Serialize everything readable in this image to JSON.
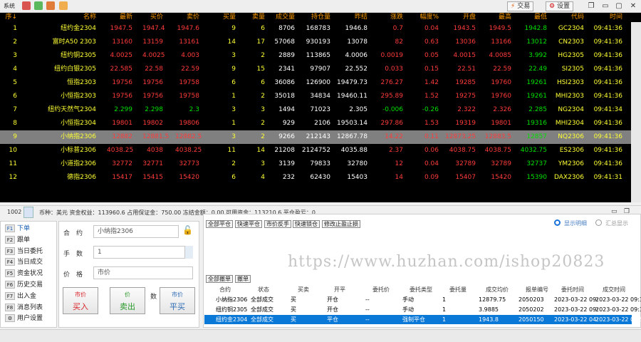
{
  "titlebar": {
    "system_label": "系统",
    "trade_button": "交易",
    "settings_button": "设置",
    "win_restore": "❐",
    "win_min": "▭",
    "win_max": "▢",
    "win_close": "✕"
  },
  "quote_table": {
    "columns": [
      "序↓",
      "名称",
      "最新",
      "买价",
      "卖价",
      "买量",
      "卖量",
      "成交量",
      "持仓量",
      "昨结",
      "涨跌",
      "幅度%",
      "开盘",
      "最高",
      "最低",
      "代码",
      "时间"
    ],
    "rows": [
      {
        "idx": "1",
        "name": "纽约金2304",
        "last": "1947.5",
        "bid": "1947.4",
        "ask": "1947.6",
        "bidv": "9",
        "askv": "6",
        "vol": "8706",
        "oi": "168783",
        "prev": "1946.8",
        "chg": "0.7",
        "pct": "0.04",
        "open": "1943.5",
        "high": "1949.5",
        "low": "1942.8",
        "code": "GC2304",
        "time": "09:41:36",
        "dir": "up"
      },
      {
        "idx": "2",
        "name": "富时A50 2303",
        "last": "13160",
        "bid": "13159",
        "ask": "13161",
        "bidv": "14",
        "askv": "17",
        "vol": "57068",
        "oi": "930193",
        "prev": "13078",
        "chg": "82",
        "pct": "0.63",
        "open": "13036",
        "high": "13166",
        "low": "13012",
        "code": "CN2303",
        "time": "09:41:36",
        "dir": "up"
      },
      {
        "idx": "3",
        "name": "纽约铜2305",
        "last": "4.0025",
        "bid": "4.0025",
        "ask": "4.003",
        "bidv": "3",
        "askv": "2",
        "vol": "2889",
        "oi": "113865",
        "prev": "4.0006",
        "chg": "0.0019",
        "pct": "0.05",
        "open": "4.0015",
        "high": "4.0085",
        "low": "3.992",
        "code": "HG2305",
        "time": "09:41:36",
        "dir": "up"
      },
      {
        "idx": "4",
        "name": "纽约白银2305",
        "last": "22.585",
        "bid": "22.58",
        "ask": "22.59",
        "bidv": "9",
        "askv": "15",
        "vol": "2341",
        "oi": "97907",
        "prev": "22.552",
        "chg": "0.033",
        "pct": "0.15",
        "open": "22.51",
        "high": "22.59",
        "low": "22.49",
        "code": "SI2305",
        "time": "09:41:36",
        "dir": "up"
      },
      {
        "idx": "5",
        "name": "恒指2303",
        "last": "19756",
        "bid": "19756",
        "ask": "19758",
        "bidv": "6",
        "askv": "6",
        "vol": "36086",
        "oi": "126900",
        "prev": "19479.73",
        "chg": "276.27",
        "pct": "1.42",
        "open": "19285",
        "high": "19760",
        "low": "19261",
        "code": "HSI2303",
        "time": "09:41:36",
        "dir": "up"
      },
      {
        "idx": "6",
        "name": "小恒指2303",
        "last": "19756",
        "bid": "19756",
        "ask": "19758",
        "bidv": "1",
        "askv": "2",
        "vol": "35018",
        "oi": "34834",
        "prev": "19460.11",
        "chg": "295.89",
        "pct": "1.52",
        "open": "19275",
        "high": "19760",
        "low": "19261",
        "code": "MHI2303",
        "time": "09:41:36",
        "dir": "up"
      },
      {
        "idx": "7",
        "name": "纽约天然气2304",
        "last": "2.299",
        "bid": "2.298",
        "ask": "2.3",
        "bidv": "3",
        "askv": "3",
        "vol": "1494",
        "oi": "71023",
        "prev": "2.305",
        "chg": "-0.006",
        "pct": "-0.26",
        "open": "2.322",
        "high": "2.326",
        "low": "2.285",
        "code": "NG2304",
        "time": "09:41:34",
        "dir": "dn"
      },
      {
        "idx": "8",
        "name": "小恒指2304",
        "last": "19801",
        "bid": "19802",
        "ask": "19806",
        "bidv": "1",
        "askv": "2",
        "vol": "929",
        "oi": "2106",
        "prev": "19503.14",
        "chg": "297.86",
        "pct": "1.53",
        "open": "19319",
        "high": "19801",
        "low": "19316",
        "code": "MHI2304",
        "time": "09:41:36",
        "dir": "up"
      },
      {
        "idx": "9",
        "name": "小纳指2306",
        "last": "12882",
        "bid": "12881.5",
        "ask": "12882.5",
        "bidv": "3",
        "askv": "2",
        "vol": "9266",
        "oi": "212143",
        "prev": "12867.78",
        "chg": "14.22",
        "pct": "0.11",
        "open": "12873.25",
        "high": "12883.5",
        "low": "12857",
        "code": "NQ2306",
        "time": "09:41:36",
        "dir": "up",
        "selected": true
      },
      {
        "idx": "10",
        "name": "小标普2306",
        "last": "4038.25",
        "bid": "4038",
        "ask": "4038.25",
        "bidv": "11",
        "askv": "14",
        "vol": "21208",
        "oi": "2124752",
        "prev": "4035.88",
        "chg": "2.37",
        "pct": "0.06",
        "open": "4038.75",
        "high": "4038.75",
        "low": "4032.75",
        "code": "ES2306",
        "time": "09:41:36",
        "dir": "up"
      },
      {
        "idx": "11",
        "name": "小道指2306",
        "last": "32772",
        "bid": "32771",
        "ask": "32773",
        "bidv": "2",
        "askv": "3",
        "vol": "3139",
        "oi": "79833",
        "prev": "32780",
        "chg": "12",
        "pct": "0.04",
        "open": "32789",
        "high": "32789",
        "low": "32737",
        "code": "YM2306",
        "time": "09:41:36",
        "dir": "up"
      },
      {
        "idx": "12",
        "name": "德指2306",
        "last": "15417",
        "bid": "15415",
        "ask": "15420",
        "bidv": "6",
        "askv": "4",
        "vol": "232",
        "oi": "62430",
        "prev": "15403",
        "chg": "14",
        "pct": "0.09",
        "open": "15407",
        "high": "15420",
        "low": "15390",
        "code": "DAX2306",
        "time": "09:41:31",
        "dir": "up"
      }
    ]
  },
  "statusbar": {
    "account": "1002",
    "text": "币种：美元   资金权益：113960.6   占用保证金：750.00   冻结金额：0.00   可用资金：113210.6   平仓盈亏：0"
  },
  "nav": {
    "items": [
      {
        "key": "F1",
        "label": "下单"
      },
      {
        "key": "F2",
        "label": "跟单"
      },
      {
        "key": "F3",
        "label": "当日委托"
      },
      {
        "key": "F4",
        "label": "当日成交"
      },
      {
        "key": "F5",
        "label": "资金状况"
      },
      {
        "key": "F6",
        "label": "历史交易"
      },
      {
        "key": "F7",
        "label": "出入金"
      },
      {
        "key": "F8",
        "label": "消息列表"
      },
      {
        "key": "⚙",
        "label": "用户设置"
      }
    ]
  },
  "order_form": {
    "contract_label": "合　约",
    "contract_value": "小纳指2306",
    "qty_label": "手　数",
    "qty_value": "1",
    "price_label": "价　格",
    "price_value": "市价",
    "max_label": "数",
    "buy_price": "市价",
    "buy_label": "买入",
    "sell_price": "价",
    "sell_label": "卖出",
    "close_price": "市价",
    "close_label": "平买"
  },
  "right_panel": {
    "top_buttons": [
      "全部平仓",
      "快速平仓",
      "市价反手",
      "快速锁仓",
      "修改止盈止损"
    ],
    "radio_simple": "显示明细",
    "radio_detail": "汇总显示",
    "order_buttons": [
      "全部撤单",
      "撤单"
    ],
    "order_columns": [
      "合约",
      "状态",
      "买卖",
      "开平",
      "委托价",
      "委托类型",
      "委托量",
      "成交均价",
      "报单编号",
      "委托时间",
      "成交时间"
    ],
    "orders": [
      {
        "contract": "小纳指2306",
        "status": "全部成交",
        "side": "买",
        "oc": "开仓",
        "price": "--",
        "type": "手动",
        "qty": "1",
        "avg": "12879.75",
        "no": "2050203",
        "otime": "2023-03-22 09:",
        "ttime": "2023-03-22 09:3"
      },
      {
        "contract": "纽约铜2305",
        "status": "全部成交",
        "side": "买",
        "oc": "开仓",
        "price": "--",
        "type": "手动",
        "qty": "1",
        "avg": "3.9885",
        "no": "2050202",
        "otime": "2023-03-22 09:",
        "ttime": "2023-03-22 09:3"
      },
      {
        "contract": "纽约金2304",
        "status": "全部成交",
        "side": "买",
        "oc": "平仓",
        "price": "--",
        "type": "强制平仓",
        "qty": "1",
        "avg": "1943.8",
        "no": "2050150",
        "otime": "2023-03-22 04:",
        "ttime": "2023-03-22 04:5",
        "selected": true
      }
    ]
  },
  "watermark": "https://www.huzhan.com/ishop20823",
  "colors": {
    "up": "#ff3b3b",
    "down": "#00e000",
    "name": "#ffff33",
    "header": "#ff9c00",
    "selection": "#0a78d7"
  }
}
